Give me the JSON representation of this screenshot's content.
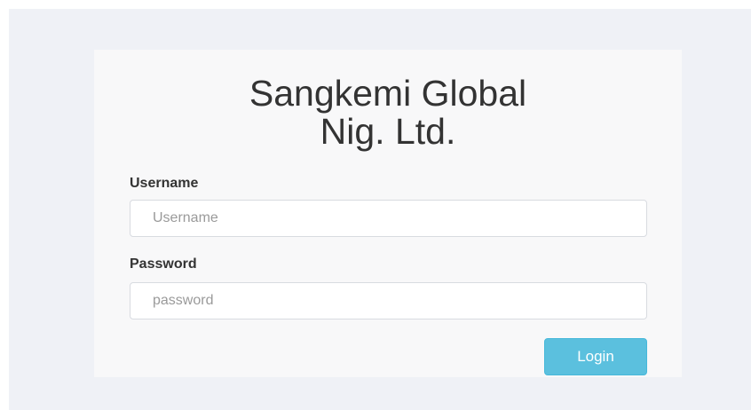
{
  "login": {
    "title_line1": "Sangkemi Global",
    "title_line2": "Nig. Ltd.",
    "username_label": "Username",
    "username_placeholder": "Username",
    "username_value": "",
    "password_label": "Password",
    "password_placeholder": "password",
    "password_value": "",
    "login_button": "Login"
  },
  "colors": {
    "page_background": "#eff1f6",
    "card_background": "#f8f8f9",
    "button_background": "#5bc0de",
    "button_text": "#ffffff",
    "text": "#333333"
  }
}
